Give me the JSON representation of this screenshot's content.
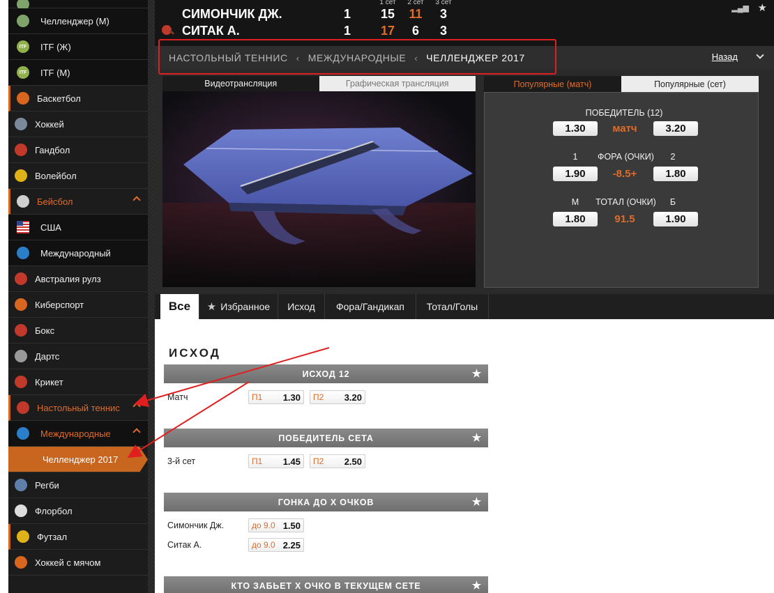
{
  "sidebar": {
    "items": [
      {
        "label": "",
        "icon": "ball-icon",
        "color": "#7fa36a",
        "style": "sub"
      },
      {
        "label": "Челленджер (М)",
        "icon": "ball-icon",
        "color": "#7fa36a",
        "style": "sub"
      },
      {
        "label": "ITF (Ж)",
        "icon": "itf-icon",
        "color": "#8fb04a",
        "style": "sub"
      },
      {
        "label": "ITF (М)",
        "icon": "itf-icon",
        "color": "#8fb04a",
        "style": "sub"
      },
      {
        "label": "Баскетбол",
        "icon": "basketball-icon",
        "color": "#d9661f",
        "style": "accent"
      },
      {
        "label": "Хоккей",
        "icon": "hockey-icon",
        "color": "#7b8a9a",
        "style": ""
      },
      {
        "label": "Гандбол",
        "icon": "handball-icon",
        "color": "#c0392b",
        "style": ""
      },
      {
        "label": "Волейбол",
        "icon": "volleyball-icon",
        "color": "#e0b21a",
        "style": ""
      },
      {
        "label": "Бейсбол",
        "icon": "baseball-icon",
        "color": "#cfcfcf",
        "style": "accent orange",
        "expanded": true
      },
      {
        "label": "США",
        "icon": "usa-flag-icon",
        "color": "#33488a",
        "style": "sub flagitem"
      },
      {
        "label": "Международный",
        "icon": "globe-icon",
        "color": "#2a7fc8",
        "style": "sub"
      },
      {
        "label": "Австралия рулз",
        "icon": "aussie-rules-icon",
        "color": "#c0392b",
        "style": ""
      },
      {
        "label": "Киберспорт",
        "icon": "esports-icon",
        "color": "#d9661f",
        "style": ""
      },
      {
        "label": "Бокс",
        "icon": "boxing-icon",
        "color": "#c0392b",
        "style": ""
      },
      {
        "label": "Дартс",
        "icon": "darts-icon",
        "color": "#9a9a9a",
        "style": ""
      },
      {
        "label": "Крикет",
        "icon": "cricket-icon",
        "color": "#c0392b",
        "style": ""
      },
      {
        "label": "Настольный теннис",
        "icon": "table-tennis-icon",
        "color": "#c0392b",
        "style": "accent orange",
        "expanded": true
      },
      {
        "label": "Международные",
        "icon": "globe-icon",
        "color": "#2a7fc8",
        "style": "sub orange",
        "expanded": true
      },
      {
        "label": "Челленджер 2017",
        "icon": "",
        "color": "",
        "style": "active-leaf"
      },
      {
        "label": "Регби",
        "icon": "rugby-icon",
        "color": "#5d7fa8",
        "style": ""
      },
      {
        "label": "Флорбол",
        "icon": "floorball-icon",
        "color": "#dddddd",
        "style": ""
      },
      {
        "label": "Футзал",
        "icon": "futsal-icon",
        "color": "#e0b21a",
        "style": "accent"
      },
      {
        "label": "Хоккей с мячом",
        "icon": "bandy-icon",
        "color": "#d9661f",
        "style": ""
      }
    ]
  },
  "scoreboard": {
    "set_headers": [
      "1 сет",
      "2 сет",
      "3 сет"
    ],
    "players": [
      {
        "name": "СИМОНЧИК ДЖ.",
        "sets": "1",
        "s1": "15",
        "s2": "11",
        "s3": "3",
        "s1_orange": false,
        "s2_orange": true
      },
      {
        "name": "СИТАК А.",
        "sets": "1",
        "s1": "17",
        "s2": "6",
        "s3": "3",
        "s1_orange": true,
        "s2_orange": false
      }
    ]
  },
  "breadcrumb": {
    "items": [
      "НАСТОЛЬНЫЙ ТЕННИС",
      "МЕЖДУНАРОДНЫЕ",
      "ЧЕЛЛЕНДЖЕР 2017"
    ],
    "back_label": "Назад"
  },
  "video_tabs": [
    "Видеотрансляция",
    "Графическая трансляция"
  ],
  "popular": {
    "tabs": [
      "Популярные (матч)",
      "Популярные (сет)"
    ],
    "winner": {
      "title": "ПОБЕДИТЕЛЬ (12)",
      "left": "1.30",
      "mid": "матч",
      "right": "3.20"
    },
    "handicap": {
      "left_label": "1",
      "title": "ФОРА (ОЧКИ)",
      "right_label": "2",
      "left": "1.90",
      "mid": "-8.5+",
      "right": "1.80"
    },
    "total": {
      "left_label": "М",
      "title": "ТОТАЛ (ОЧКИ)",
      "right_label": "Б",
      "left": "1.80",
      "mid": "91.5",
      "right": "1.90"
    }
  },
  "market_tabs": [
    "Все",
    "Избранное",
    "Исход",
    "Фора/Гандикап",
    "Тотал/Голы"
  ],
  "content": {
    "section_title": "ИСХОД",
    "markets": [
      {
        "title": "ИСХОД 12",
        "rows": [
          {
            "label": "Матч",
            "odds": [
              {
                "l": "П1",
                "v": "1.30"
              },
              {
                "l": "П2",
                "v": "3.20"
              }
            ]
          }
        ]
      },
      {
        "title": "ПОБЕДИТЕЛЬ СЕТА",
        "rows": [
          {
            "label": "3-й сет",
            "odds": [
              {
                "l": "П1",
                "v": "1.45"
              },
              {
                "l": "П2",
                "v": "2.50"
              }
            ]
          }
        ]
      },
      {
        "title": "ГОНКА ДО X ОЧКОВ",
        "rows": [
          {
            "label": "Симончик Дж.",
            "odds": [
              {
                "l": "до 9.0",
                "v": "1.50"
              }
            ]
          },
          {
            "label": "Ситак А.",
            "odds": [
              {
                "l": "до 9.0",
                "v": "2.25"
              }
            ]
          }
        ]
      },
      {
        "title": "КТО ЗАБЬЕТ X ОЧКО В ТЕКУЩЕМ СЕТЕ",
        "rows": []
      }
    ]
  },
  "colors": {
    "accent": "#e06c2a",
    "active": "#c8651e",
    "annotation": "#e02020"
  }
}
